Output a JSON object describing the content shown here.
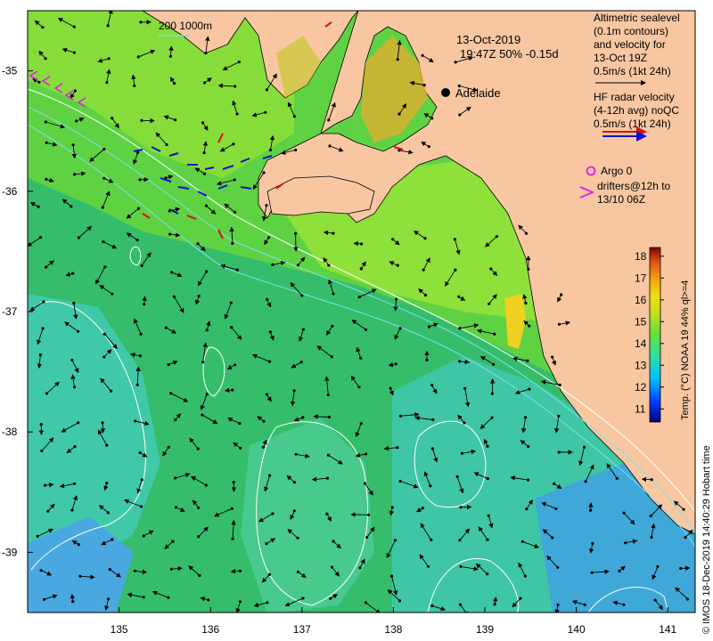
{
  "map": {
    "date_label": "13-Oct-2019",
    "time_label": "19:47Z  50% -0.15d",
    "city_label": "Adelaide",
    "scale_label": "200  1000m",
    "legend_altimetric": [
      "Altimetric sealevel",
      "(0.1m contours)",
      "and velocity for",
      "13-Oct 19Z",
      "0.5m/s (1kt 24h)"
    ],
    "legend_hf": [
      "HF radar velocity",
      "(4-12h avg) noQC",
      "0.5m/s (1kt 24h)"
    ],
    "legend_argo": "Argo 0",
    "legend_drifters": [
      "drifters@12h to",
      "13/10 06Z"
    ],
    "colorbar_label": "Temp. (°C) NOAA 19 44% ql>=4",
    "colorbar_ticks": [
      "11",
      "12",
      "13",
      "14",
      "15",
      "16",
      "17",
      "18"
    ],
    "colorbar_range": [
      10.4,
      18.4
    ],
    "credit": "© IMOS 18-Dec-2019 14:40:29 Hobart time",
    "lon_ticks": [
      "135",
      "136",
      "137",
      "138",
      "139",
      "140",
      "141"
    ],
    "lat_ticks": [
      "-35",
      "-36",
      "-37",
      "-38",
      "-39"
    ],
    "lon_range": [
      134.0,
      141.3
    ],
    "lat_range": [
      -39.5,
      -34.5
    ],
    "colors": {
      "land": "#f8c7a1",
      "sea_deep": "#39b86a",
      "sea_mid": "#5cd34a",
      "sea_cool": "#3ecfb0",
      "sea_cold": "#49a9e0",
      "contour": "#ffffff",
      "arrow": "#000000",
      "argo": "#e020e0",
      "hf_red": "#dd1111",
      "hf_blue": "#1111cc"
    }
  }
}
